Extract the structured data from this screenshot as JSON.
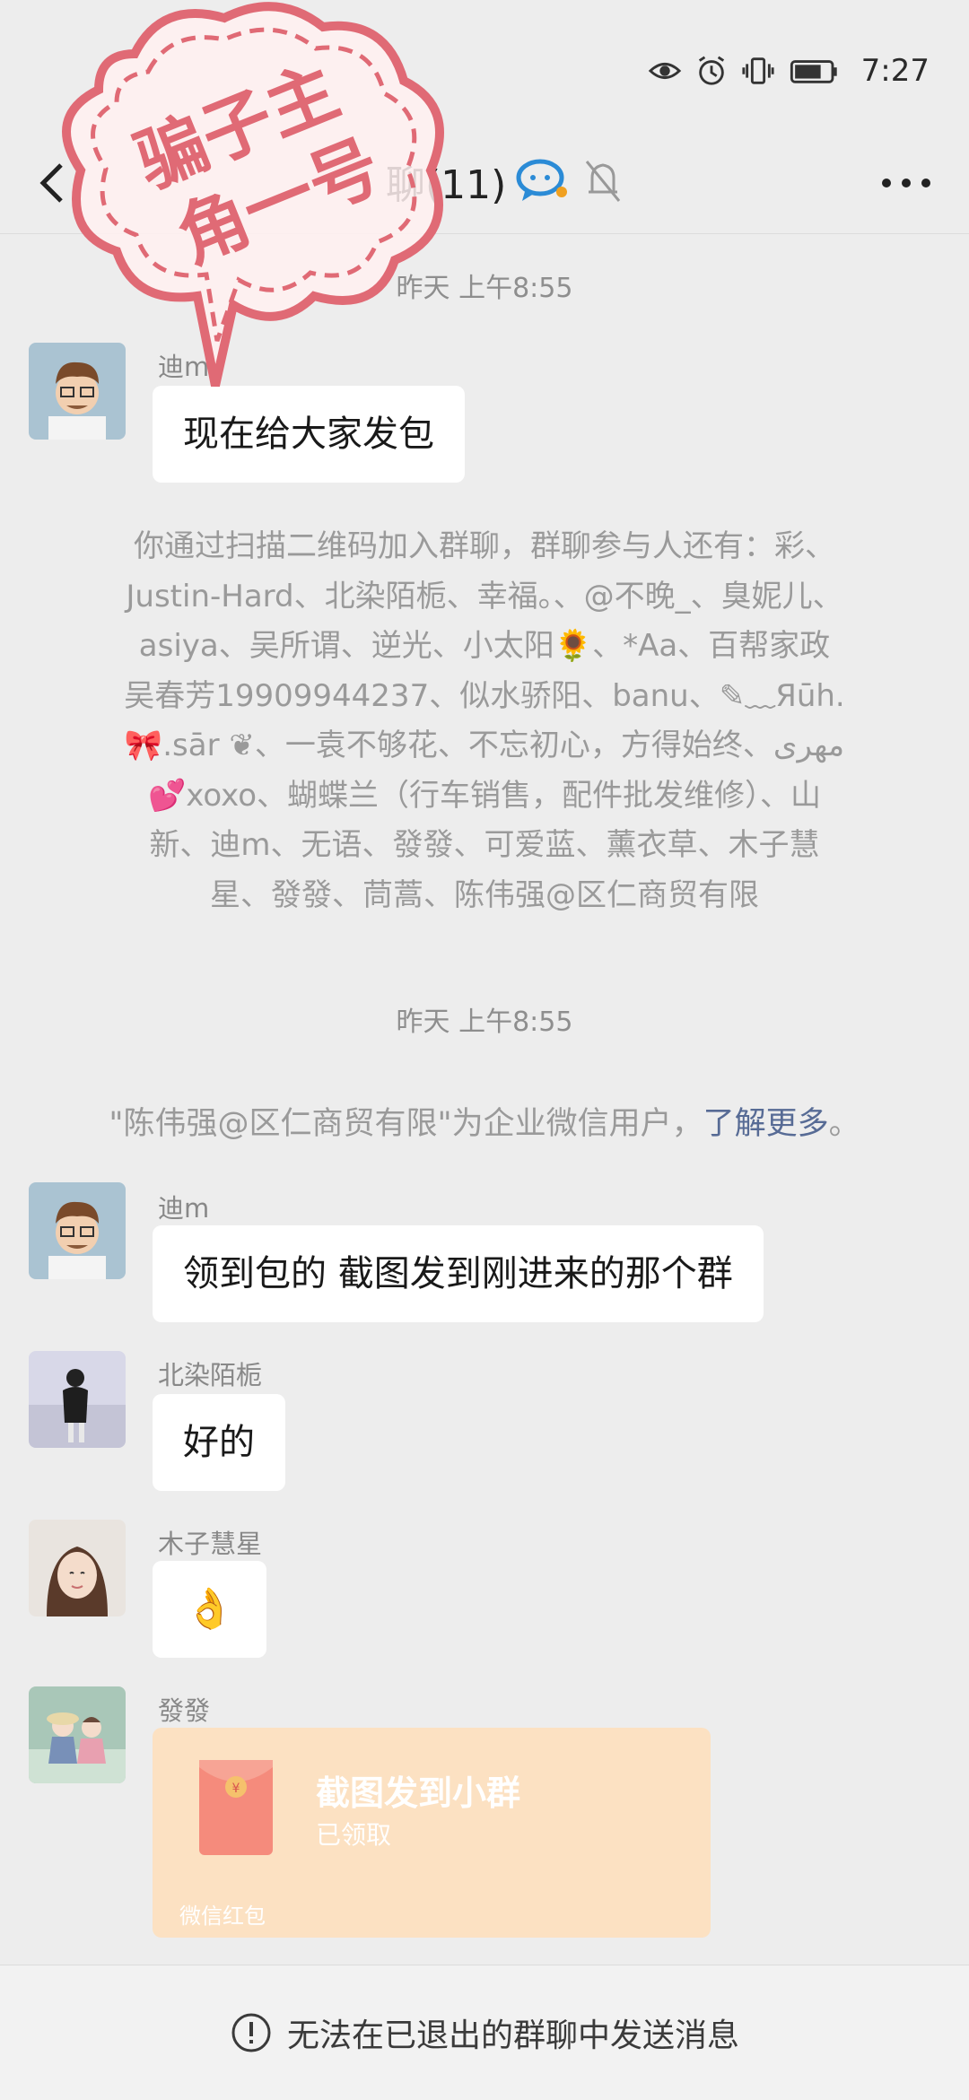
{
  "status_bar": {
    "time": "7:27"
  },
  "header": {
    "title": "聊(11)"
  },
  "messages_top": {
    "timestamp": "昨天 上午8:55",
    "sender": "迪m",
    "text": "现在给大家发包"
  },
  "system_join": {
    "lines": [
      "你通过扫描二维码加入群聊，群聊参与人还有：彩、",
      "Justin-Hard、北染陌栀、幸福。、@不晚_、臭妮儿、",
      "asiya、吴所谓、逆光、小太阳🌻、*Aa、百帮家政",
      "吴春芳19909944237、似水骄阳、banu、✎﹏Яūh.",
      "🎀.sār ❦、一袁不够花、不忘初心，方得始终、مهرى",
      "💕xoxo、蝴蝶兰（行车销售，配件批发维修）、山",
      "新、迪m、无语、發發、可爱蓝、薰衣草、木子慧",
      "星、發發、茼蒿、陈伟强@区仁商贸有限"
    ]
  },
  "timestamp2": "昨天 上午8:55",
  "enterprise_notice": {
    "text": "\"陈伟强@区仁商贸有限\"为企业微信用户，",
    "link": "了解更多",
    "end": "。"
  },
  "messages": [
    {
      "sender": "迪m",
      "text": "领到包的 截图发到刚进来的那个群"
    },
    {
      "sender": "北染陌栀",
      "text": "好的"
    },
    {
      "sender": "木子慧星",
      "text": "👌"
    },
    {
      "sender": "發發"
    }
  ],
  "red_packet": {
    "title": "截图发到小群",
    "status": "已领取",
    "label": "微信红包",
    "color": "#fce1c2"
  },
  "stamp": {
    "line1": "骗子主",
    "line2": "角一号",
    "color": "#e06a75"
  },
  "bottom_notice": "无法在已退出的群聊中发送消息",
  "colors": {
    "background": "#ededed",
    "bubble": "#ffffff",
    "link": "#576b95"
  }
}
